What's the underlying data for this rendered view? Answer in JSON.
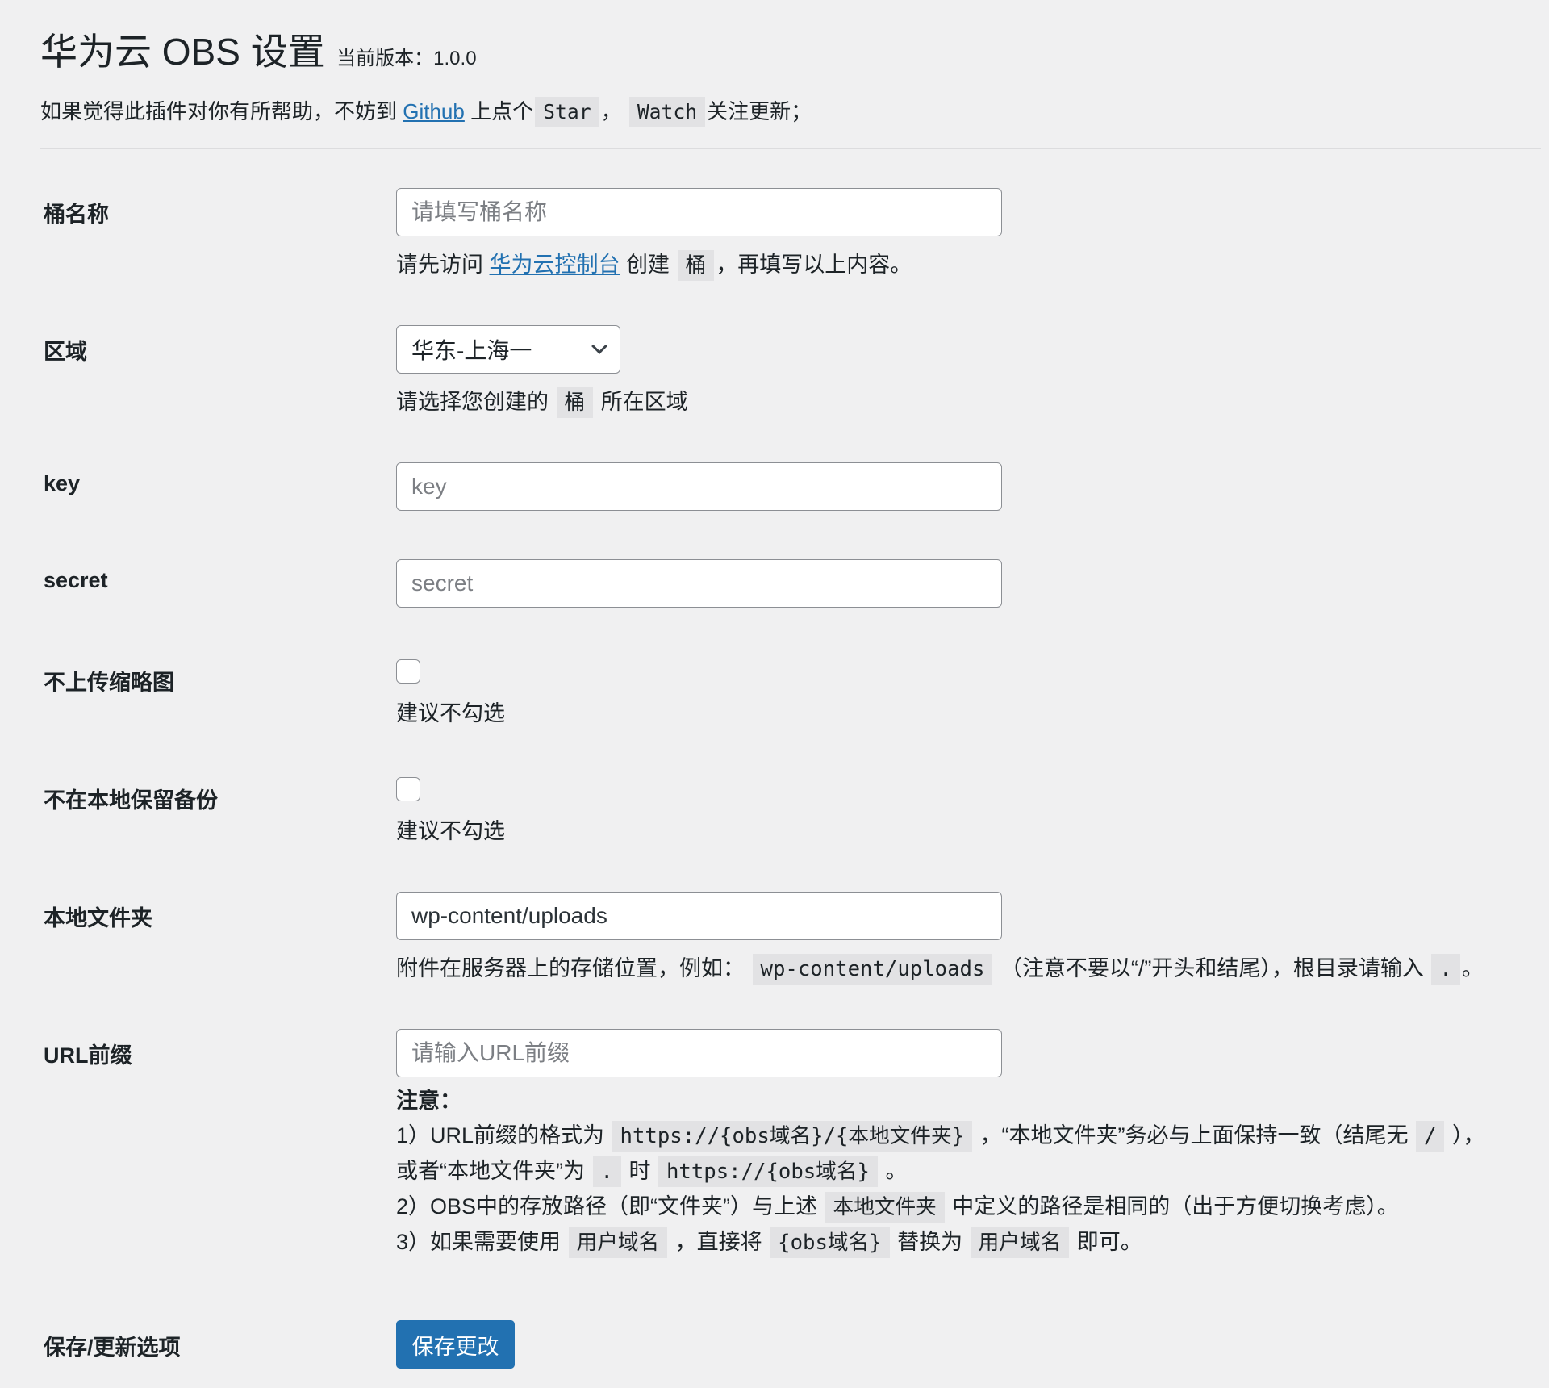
{
  "header": {
    "title": "华为云 OBS 设置",
    "version": "当前版本：1.0.0"
  },
  "intro": {
    "prefix": "如果觉得此插件对你有所帮助，不妨到",
    "link": "Github",
    "middle": "上点个",
    "star": "Star",
    "sep": "，",
    "watch": "Watch",
    "suffix": "关注更新；"
  },
  "fields": {
    "bucket": {
      "label": "桶名称",
      "placeholder": "请填写桶名称",
      "desc_prefix": "请先访问",
      "desc_link": "华为云控制台",
      "desc_mid": "创建",
      "desc_code": "桶",
      "desc_suffix": "，再填写以上内容。"
    },
    "region": {
      "label": "区域",
      "value": "华东-上海一",
      "desc_prefix": "请选择您创建的",
      "desc_code": "桶",
      "desc_suffix": "所在区域"
    },
    "key": {
      "label": "key",
      "placeholder": "key"
    },
    "secret": {
      "label": "secret",
      "placeholder": "secret"
    },
    "no_thumb": {
      "label": "不上传缩略图",
      "checked": false,
      "desc": "建议不勾选"
    },
    "no_local": {
      "label": "不在本地保留备份",
      "checked": false,
      "desc": "建议不勾选"
    },
    "local_dir": {
      "label": "本地文件夹",
      "value": "wp-content/uploads",
      "desc_prefix": "附件在服务器上的存储位置，例如：",
      "desc_code": "wp-content/uploads",
      "desc_mid": "（注意不要以“/”开头和结尾），根目录请输入",
      "desc_code2": ".",
      "desc_suffix": "。"
    },
    "url_prefix": {
      "label": "URL前缀",
      "placeholder": "请输入URL前缀",
      "note_title": "注意：",
      "note1_a": "1）URL前缀的格式为",
      "note1_code": "https://{obs域名}/{本地文件夹}",
      "note1_b": "，“本地文件夹”务必与上面保持一致（结尾无",
      "note1_code2": "/",
      "note1_c": "），",
      "note1b_a": "或者“本地文件夹”为",
      "note1b_code": ".",
      "note1b_b": "时",
      "note1b_code2": "https://{obs域名}",
      "note1b_c": "。",
      "note2_a": "2）OBS中的存放路径（即“文件夹”）与上述",
      "note2_code": "本地文件夹",
      "note2_b": "中定义的路径是相同的（出于方便切换考虑）。",
      "note3_a": "3）如果需要使用",
      "note3_code": "用户域名",
      "note3_b": "，直接将",
      "note3_code2": "{obs域名}",
      "note3_c": "替换为",
      "note3_code3": "用户域名",
      "note3_d": "即可。"
    }
  },
  "save": {
    "label": "保存/更新选项",
    "button": "保存更改"
  },
  "colors": {
    "accent": "#2271b1",
    "background": "#f0f0f1"
  }
}
